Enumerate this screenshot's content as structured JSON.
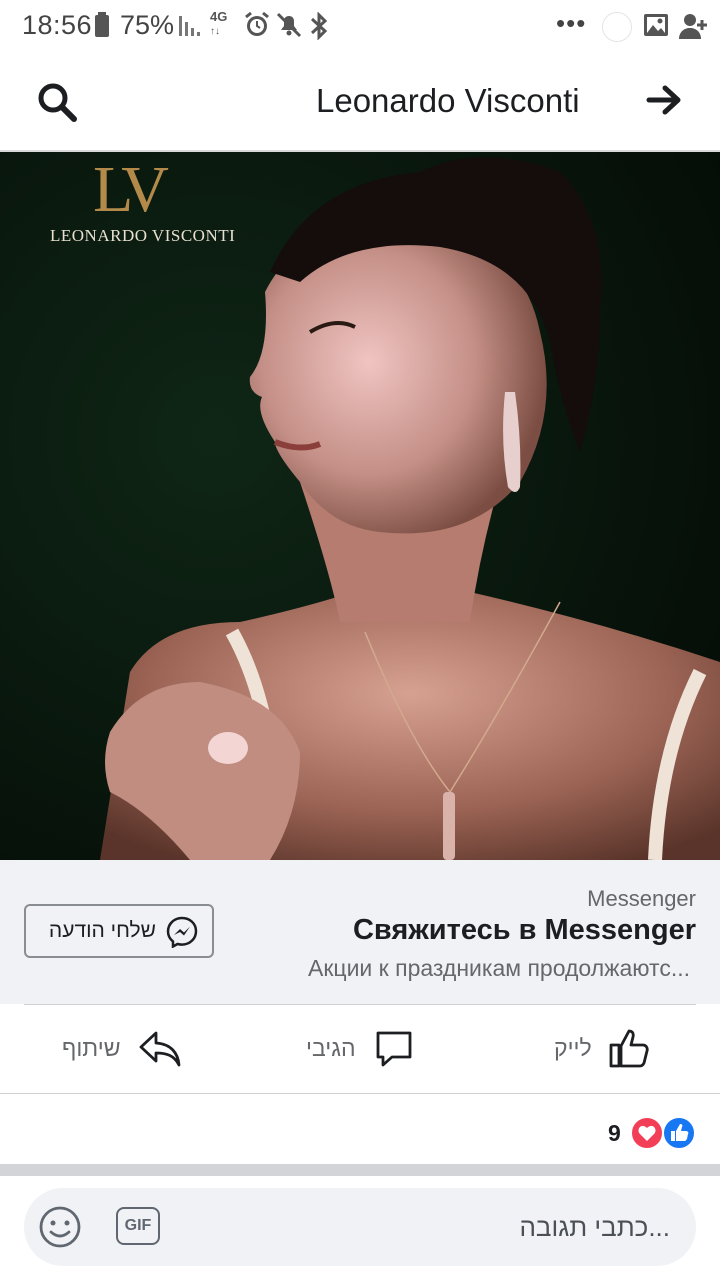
{
  "status_bar": {
    "time": "18:56",
    "battery": "75%",
    "network": "4G",
    "icons": [
      "battery-icon",
      "signal-icon",
      "alarm-icon",
      "mute-icon",
      "bluetooth-icon",
      "more-dots-icon",
      "image-icon",
      "person-add-icon"
    ],
    "more": "•••"
  },
  "header": {
    "title": "Leonardo Visconti",
    "search_icon": "search-icon",
    "forward_icon": "arrow-right-icon"
  },
  "ad_image": {
    "monogram": "LV",
    "brand": "LEONARDO VISCONTI"
  },
  "cta": {
    "source": "Messenger",
    "headline": "Свяжитесь в Messenger",
    "description": "Акции к праздникам продолжаютс...",
    "button_label": "שלחי הודעה"
  },
  "actions": {
    "like": "לייק",
    "comment": "הגיבי",
    "share": "שיתוף"
  },
  "reactions": {
    "count": "9",
    "types": [
      "like-reaction-icon",
      "love-reaction-icon"
    ],
    "colors": {
      "like": "#1877f2",
      "love": "#f33e58"
    }
  },
  "comment_bar": {
    "placeholder": "...כתבי תגובה",
    "gif_label": "GIF"
  }
}
